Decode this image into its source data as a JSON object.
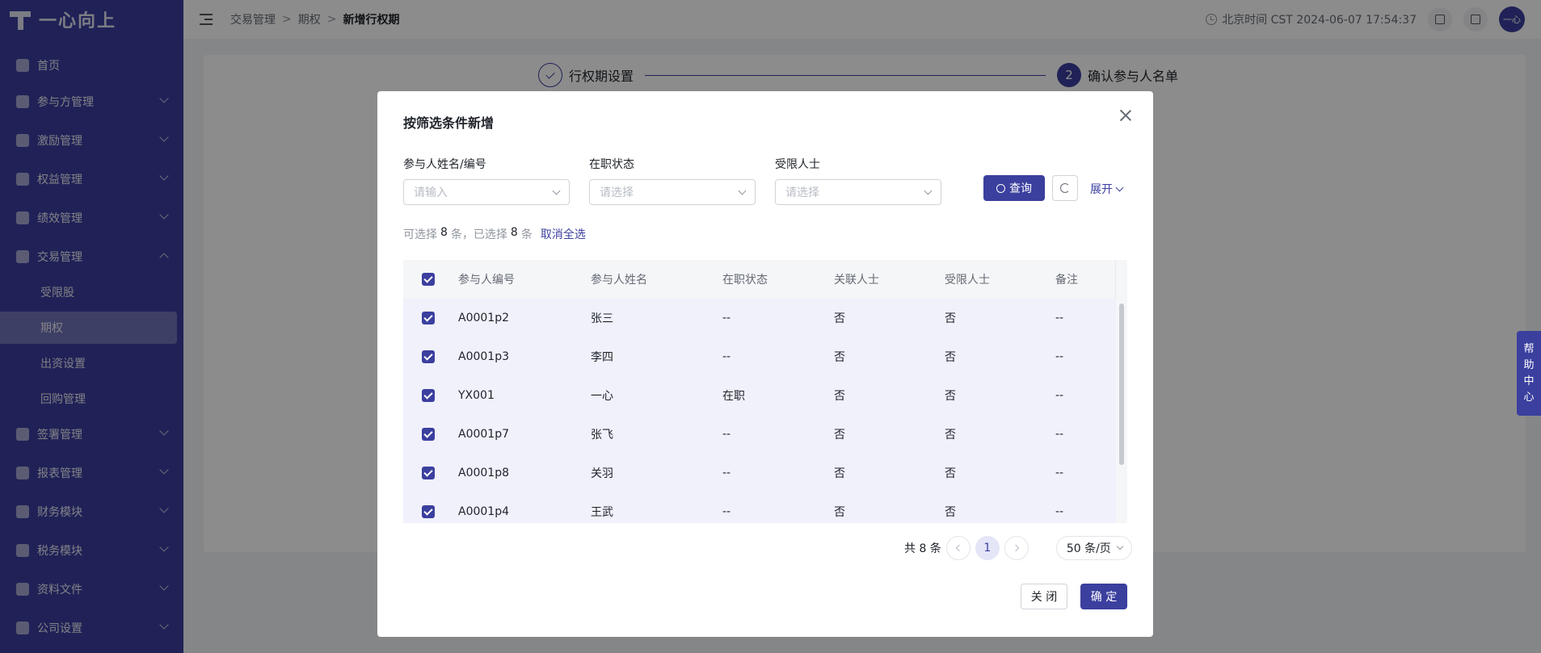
{
  "app": {
    "logo_text": "一心向上"
  },
  "sidebar": {
    "items": [
      {
        "label": "首页"
      },
      {
        "label": "参与方管理"
      },
      {
        "label": "激励管理"
      },
      {
        "label": "权益管理"
      },
      {
        "label": "绩效管理"
      },
      {
        "label": "交易管理"
      },
      {
        "label": "签署管理"
      },
      {
        "label": "报表管理"
      },
      {
        "label": "财务模块"
      },
      {
        "label": "税务模块"
      },
      {
        "label": "资料文件"
      },
      {
        "label": "公司设置"
      }
    ],
    "subitems": [
      {
        "label": "受限股"
      },
      {
        "label": "期权"
      },
      {
        "label": "出资设置"
      },
      {
        "label": "回购管理"
      }
    ]
  },
  "header": {
    "breadcrumb": [
      "交易管理",
      "期权",
      "新增行权期"
    ],
    "clock": "北京时间 CST 2024-06-07 17:54:37",
    "avatar_text": "一心"
  },
  "steps": [
    {
      "label": "行权期设置"
    },
    {
      "number": "2",
      "label": "确认参与人名单"
    }
  ],
  "help": {
    "text": [
      "帮",
      "助",
      "中",
      "心"
    ]
  },
  "modal": {
    "title": "按筛选条件新增",
    "filters": [
      {
        "label": "参与人姓名/编号",
        "placeholder": "请输入"
      },
      {
        "label": "在职状态",
        "placeholder": "请选择"
      },
      {
        "label": "受限人士",
        "placeholder": "请选择"
      }
    ],
    "query_label": "查询",
    "expand_label": "展开",
    "selection": {
      "prefix": "可选择",
      "available": "8",
      "mid": "条，已选择",
      "selected": "8",
      "suffix": "条",
      "clear_label": "取消全选"
    },
    "table": {
      "columns": [
        "参与人编号",
        "参与人姓名",
        "在职状态",
        "关联人士",
        "受限人士",
        "备注"
      ],
      "rows": [
        [
          "A0001p2",
          "张三",
          "--",
          "否",
          "否",
          "--"
        ],
        [
          "A0001p3",
          "李四",
          "--",
          "否",
          "否",
          "--"
        ],
        [
          "YX001",
          "一心",
          "在职",
          "否",
          "否",
          "--"
        ],
        [
          "A0001p7",
          "张飞",
          "--",
          "否",
          "否",
          "--"
        ],
        [
          "A0001p8",
          "关羽",
          "--",
          "否",
          "否",
          "--"
        ],
        [
          "A0001p4",
          "王武",
          "--",
          "否",
          "否",
          "--"
        ]
      ]
    },
    "pagination": {
      "total": "共 8 条",
      "current_page": "1",
      "page_size": "50 条/页"
    },
    "cancel_label": "关 闭",
    "ok_label": "确 定"
  },
  "colors": {
    "brand": "#3b3f9e",
    "row_selected": "#f0f1fb"
  }
}
